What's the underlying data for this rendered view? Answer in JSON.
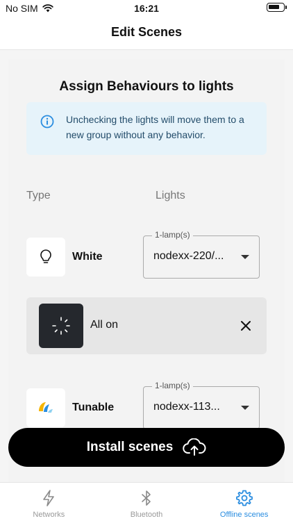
{
  "status_bar": {
    "carrier": "No SIM",
    "time": "16:21"
  },
  "nav": {
    "title": "Edit Scenes"
  },
  "main": {
    "heading": "Assign Behaviours to lights",
    "info_text": "Unchecking the lights will move them to a new group without any behavior.",
    "columns": {
      "type": "Type",
      "lights": "Lights"
    },
    "rows": [
      {
        "type": "White",
        "icon": "bulb-icon",
        "legend": "1-lamp(s)",
        "value": "nodexx-220/..."
      },
      {
        "type": "Tunable",
        "icon": "tunable-color-icon",
        "legend": "1-lamp(s)",
        "value": "nodexx-113..."
      }
    ],
    "behavior": {
      "label": "All on",
      "icon": "loading-spinner-icon"
    }
  },
  "install_button": {
    "label": "Install scenes"
  },
  "tabs": [
    {
      "label": "Networks",
      "icon": "lightning-icon",
      "active": false
    },
    {
      "label": "Bluetooth",
      "icon": "bluetooth-icon",
      "active": false
    },
    {
      "label": "Offline scenes",
      "icon": "gear-icon",
      "active": true
    }
  ],
  "colors": {
    "accent": "#2a8de0",
    "info_bg": "#e6f3fa",
    "info_fg": "#234c6a",
    "button_bg": "#000000",
    "thumb_bg": "#25282d"
  }
}
